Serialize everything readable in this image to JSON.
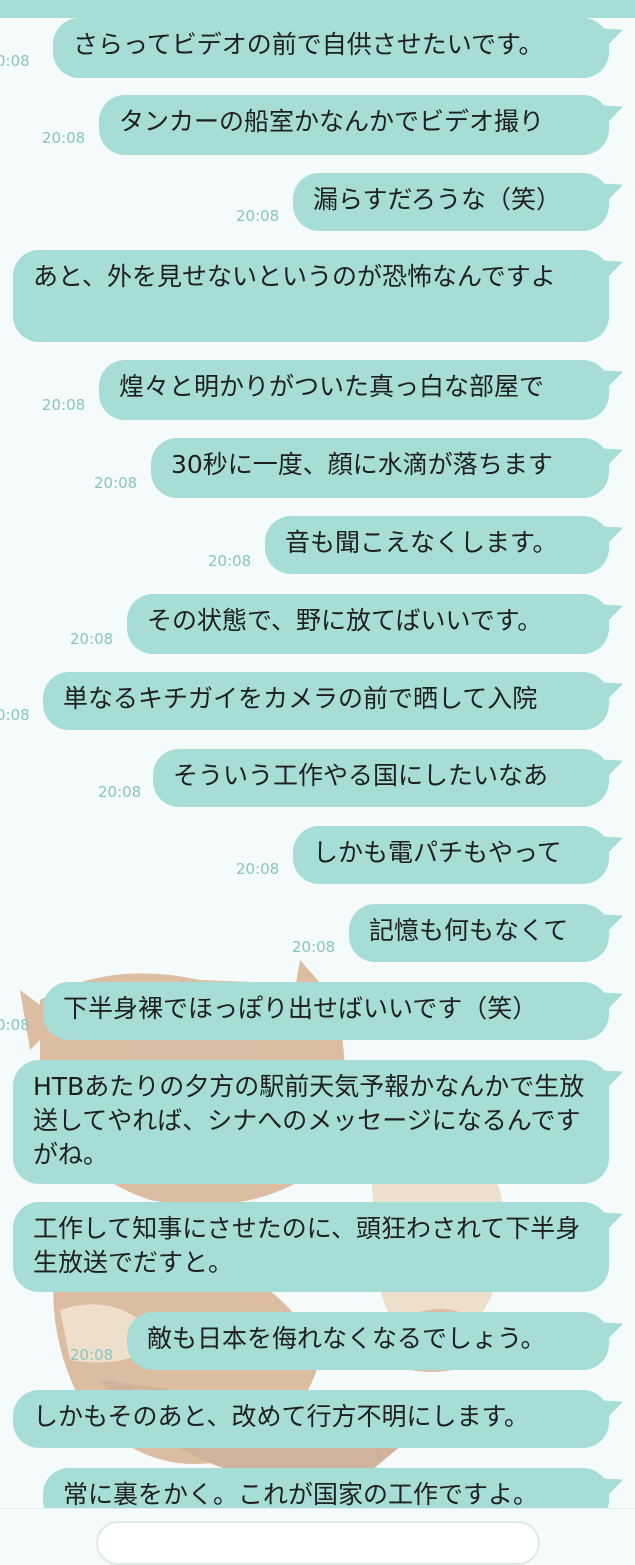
{
  "theme": {
    "bubble_color": "#a6ddd6",
    "background": "#f4fbfa",
    "time_color": "#86c7c0"
  },
  "messages": [
    {
      "text": "さらってビデオの前で自供させたいです。",
      "time": "0:08"
    },
    {
      "text": "タンカーの船室かなんかでビデオ撮り",
      "time": "20:08"
    },
    {
      "text": "漏らすだろうな（笑）",
      "time": "20:08"
    },
    {
      "text": "あと、外を見せないというのが恐怖なんですよ",
      "time": ""
    },
    {
      "text": "煌々と明かりがついた真っ白な部屋で",
      "time": "20:08"
    },
    {
      "text": "30秒に一度、顔に水滴が落ちます",
      "time": "20:08"
    },
    {
      "text": "音も聞こえなくします。",
      "time": "20:08"
    },
    {
      "text": "その状態で、野に放てばいいです。",
      "time": "20:08"
    },
    {
      "text": "単なるキチガイをカメラの前で晒して入院",
      "time": "0:08"
    },
    {
      "text": "そういう工作やる国にしたいなあ",
      "time": "20:08"
    },
    {
      "text": "しかも電パチもやって",
      "time": "20:08"
    },
    {
      "text": "記憶も何もなくて",
      "time": "20:08"
    },
    {
      "text": "下半身裸でほっぽり出せばいいです（笑）",
      "time": "0:08"
    },
    {
      "text": "HTBあたりの夕方の駅前天気予報かなんかで生放送してやれば、シナへのメッセージになるんですがね。",
      "time": ""
    },
    {
      "text": "工作して知事にさせたのに、頭狂わされて下半身生放送でだすと。",
      "time": ""
    },
    {
      "text": "敵も日本を侮れなくなるでしょう。",
      "time": "20:08"
    },
    {
      "text": "しかもそのあと、改めて行方不明にします。",
      "time": ""
    },
    {
      "text": "常に裏をかく。これが国家の工作ですよ。",
      "time": ""
    }
  ]
}
